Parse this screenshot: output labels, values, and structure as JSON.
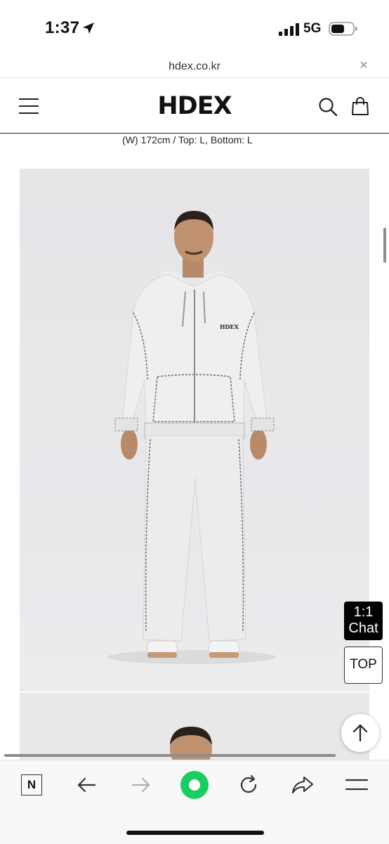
{
  "status_bar": {
    "time": "1:37",
    "network": "5G"
  },
  "browser": {
    "url": "hdex.co.kr",
    "close_glyph": "×"
  },
  "site": {
    "logo": "HDEX",
    "model_info": "(W) 172cm / Top: L, Bottom: L"
  },
  "product_image": {
    "brand_print": "HDEX"
  },
  "floating": {
    "chat_label_1": "1:1",
    "chat_label_2": "Chat",
    "top_label": "TOP"
  },
  "toolbar": {
    "icons": [
      "naver-n-icon",
      "back-arrow-icon",
      "forward-arrow-icon",
      "green-circle-icon",
      "reload-icon",
      "share-icon",
      "menu-icon"
    ],
    "naver_glyph": "N"
  },
  "colors": {
    "accent_green": "#19ce60",
    "text": "#111111",
    "photo_bg": "#e8e8eb"
  }
}
